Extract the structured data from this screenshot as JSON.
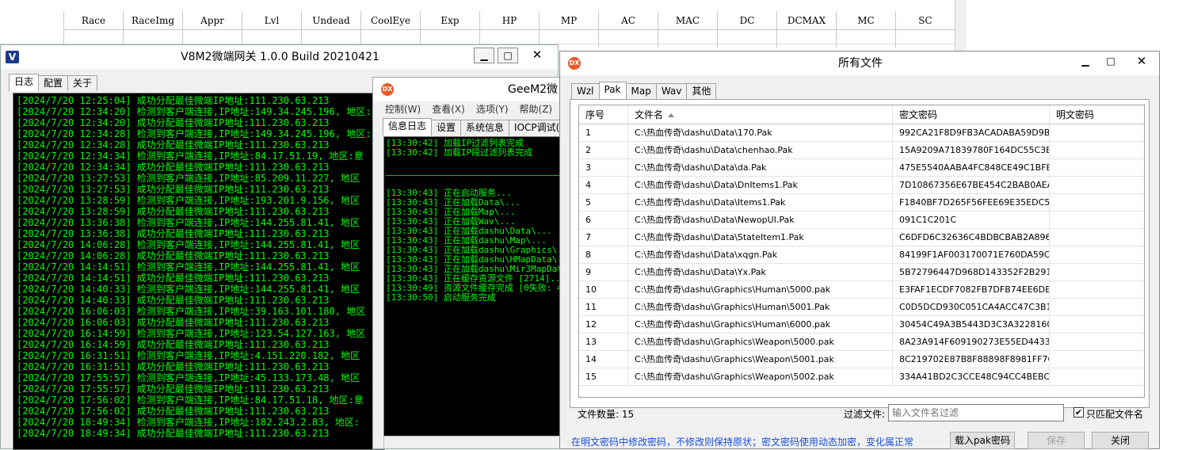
{
  "sheet": {
    "columns": [
      "Race",
      "RaceImg",
      "Appr",
      "Lvl",
      "Undead",
      "CoolEye",
      "Exp",
      "HP",
      "MP",
      "AC",
      "MAC",
      "DC",
      "DCMAX",
      "MC",
      "SC"
    ]
  },
  "v8m2": {
    "title": "V8M2微端网关 1.0.0 Build 20210421",
    "logo": "V",
    "tabs": [
      "日志",
      "配置",
      "关于"
    ],
    "log": [
      "[2024/7/20 12:25:04] 成功分配最佳微端IP地址:111.230.63.213",
      "[2024/7/20 12:34:20] 检测到客户端连接,IP地址:149.34.245.196, 地区:",
      "[2024/7/20 12:34:20] 成功分配最佳微端IP地址:111.230.63.213",
      "[2024/7/20 12:34:28] 检测到客户端连接,IP地址:149.34.245.196, 地区:",
      "[2024/7/20 12:34:28] 成功分配最佳微端IP地址:111.230.63.213",
      "[2024/7/20 12:34:34] 检测到客户端连接,IP地址:84.17.51.19, 地区:意",
      "[2024/7/20 12:34:34] 成功分配最佳微端IP地址:111.230.63.213",
      "[2024/7/20 13:27:53] 检测到客户端连接,IP地址:85.209.11.227, 地区",
      "[2024/7/20 13:27:53] 成功分配最佳微端IP地址:111.230.63.213",
      "[2024/7/20 13:28:59] 检测到客户端连接,IP地址:193.201.9.156, 地区",
      "[2024/7/20 13:28:59] 成功分配最佳微端IP地址:111.230.63.213",
      "[2024/7/20 13:36:38] 检测到客户端连接,IP地址:144.255.81.41, 地区",
      "[2024/7/20 13:36:38] 成功分配最佳微端IP地址:111.230.63.213",
      "[2024/7/20 14:06:28] 检测到客户端连接,IP地址:144.255.81.41, 地区",
      "[2024/7/20 14:06:28] 成功分配最佳微端IP地址:111.230.63.213",
      "[2024/7/20 14:14:51] 检测到客户端连接,IP地址:144.255.81.41, 地区",
      "[2024/7/20 14:14:51] 成功分配最佳微端IP地址:111.230.63.213",
      "[2024/7/20 14:40:33] 检测到客户端连接,IP地址:144.255.81.41, 地区",
      "[2024/7/20 14:40:33] 成功分配最佳微端IP地址:111.230.63.213",
      "[2024/7/20 16:06:03] 检测到客户端连接,IP地址:39.163.101.180, 地区",
      "[2024/7/20 16:06:03] 成功分配最佳微端IP地址:111.230.63.213",
      "[2024/7/20 16:14:59] 检测到客户端连接,IP地址:123.54.127.163, 地区",
      "[2024/7/20 16:14:59] 成功分配最佳微端IP地址:111.230.63.213",
      "[2024/7/20 16:31:51] 检测到客户端连接,IP地址:4.151.220.182, 地区",
      "[2024/7/20 16:31:51] 成功分配最佳微端IP地址:111.230.63.213",
      "[2024/7/20 17:55:57] 检测到客户端连接,IP地址:45.133.173.48, 地区",
      "[2024/7/20 17:55:57] 成功分配最佳微端IP地址:111.230.63.213",
      "[2024/7/20 17:56:02] 检测到客户端连接,IP地址:84.17.51.18, 地区:意",
      "[2024/7/20 17:56:02] 成功分配最佳微端IP地址:111.230.63.213",
      "[2024/7/20 18:49:34] 检测到客户端连接,IP地址:182.243.2.83, 地区:",
      "[2024/7/20 18:49:34] 成功分配最佳微端IP地址:111.230.63.213"
    ]
  },
  "geem2": {
    "title": "GeeM2微",
    "logo": "DX",
    "menu": [
      "控制(W)",
      "查看(X)",
      "选项(Y)",
      "帮助(Z)"
    ],
    "tabs": [
      "信息日志",
      "设置",
      "系统信息",
      "IOCP调试("
    ],
    "log_top": [
      "[13:30:42] 加载IP过滤列表完成",
      "[13:30:42] 加载IP段过滤列表完成"
    ],
    "log_bottom": [
      "[13:30:43] 正在启动服务...",
      "[13:30:43] 正在加载Data\\...",
      "[13:30:43] 正在加载Map\\...",
      "[13:30:43] 正在加载Wav\\...",
      "[13:30:43] 正在加载dashu\\Data\\...",
      "[13:30:43] 正在加载dashu\\Map\\...",
      "[13:30:43] 正在加载dashu\\Graphics\\...",
      "[13:30:43] 正在加载dashu\\HMapData\\...",
      "[13:30:43] 正在加载dashu\\Mir3MapData\\...",
      "[13:30:43] 正在缓存资源文件 [2714]...",
      "[13:30:49] 资源文件缓存完成 [0失败: 4",
      "[13:30:50] 启动服务完成"
    ]
  },
  "files": {
    "title": "所有文件",
    "logo": "DX",
    "tabs": [
      "Wzl",
      "Pak",
      "Map",
      "Wav",
      "其他"
    ],
    "columns": [
      "序号",
      "文件名",
      "密文密码",
      "明文密码"
    ],
    "rows": [
      [
        "1",
        "C:\\热血传奇\\dashu\\Data\\170.Pak",
        "992CA21F8D9FB3ACADABA59D9B9..."
      ],
      [
        "2",
        "C:\\热血传奇\\dashu\\Data\\chenhao.Pak",
        "15A9209A71839780F164DC55C3B1..."
      ],
      [
        "3",
        "C:\\热血传奇\\dashu\\Data\\da.Pak",
        "475E5540AABA4FC848CE49C1BFBD..."
      ],
      [
        "4",
        "C:\\热血传奇\\dashu\\Data\\DnItems1.Pak",
        "7D10867356E67BE454C2BAB0AEAA..."
      ],
      [
        "5",
        "C:\\热血传奇\\dashu\\Data\\Items1.Pak",
        "F1840BF7D265F56FEE69E35EDC5B..."
      ],
      [
        "6",
        "C:\\热血传奇\\dashu\\Data\\NewopUI.Pak",
        "091C1C201C"
      ],
      [
        "7",
        "C:\\热血传奇\\dashu\\Data\\StateItem1.Pak",
        "C6DFD6C32636C4BDBCBAB2A8968..."
      ],
      [
        "8",
        "C:\\热血传奇\\dashu\\Data\\xqgn.Pak",
        "84199F1AF003170071E760DA59C7..."
      ],
      [
        "9",
        "C:\\热血传奇\\dashu\\Data\\Yx.Pak",
        "5B72796447D968D143352F2B2917..."
      ],
      [
        "10",
        "C:\\热血传奇\\dashu\\Graphics\\Human\\5000.pak",
        "E3FAF1ECDF7082FB7DFB74EE6DEB..."
      ],
      [
        "11",
        "C:\\热血传奇\\dashu\\Graphics\\Human\\5001.Pak",
        "C0D5DCD930C051CA4ACC47C3B1A..."
      ],
      [
        "12",
        "C:\\热血传奇\\dashu\\Graphics\\Human\\6000.pak",
        "30454C49A3B5443D3C3A32281602..."
      ],
      [
        "13",
        "C:\\热血传奇\\dashu\\Graphics\\Weapon\\5000.pak",
        "8A23A914F609190273E55ED44331..."
      ],
      [
        "14",
        "C:\\热血传奇\\dashu\\Graphics\\Weapon\\5001.pak",
        "8C219702E87B8F88898F8981FF7C..."
      ],
      [
        "15",
        "C:\\热血传奇\\dashu\\Graphics\\Weapon\\5002.pak",
        "334A41BD2C3CCE48C94CC4BEBCB..."
      ]
    ],
    "count_label": "文件数量: 15",
    "filter_label": "过滤文件:",
    "filter_placeholder": "输入文件名过滤",
    "only_match_label": "只匹配文件名",
    "hint": "在明文密码中修改密码，不修改则保持原状；密文密码使用动态加密，变化属正常",
    "buttons": {
      "import": "载入pak密码",
      "save": "保存",
      "close": "关闭"
    }
  }
}
